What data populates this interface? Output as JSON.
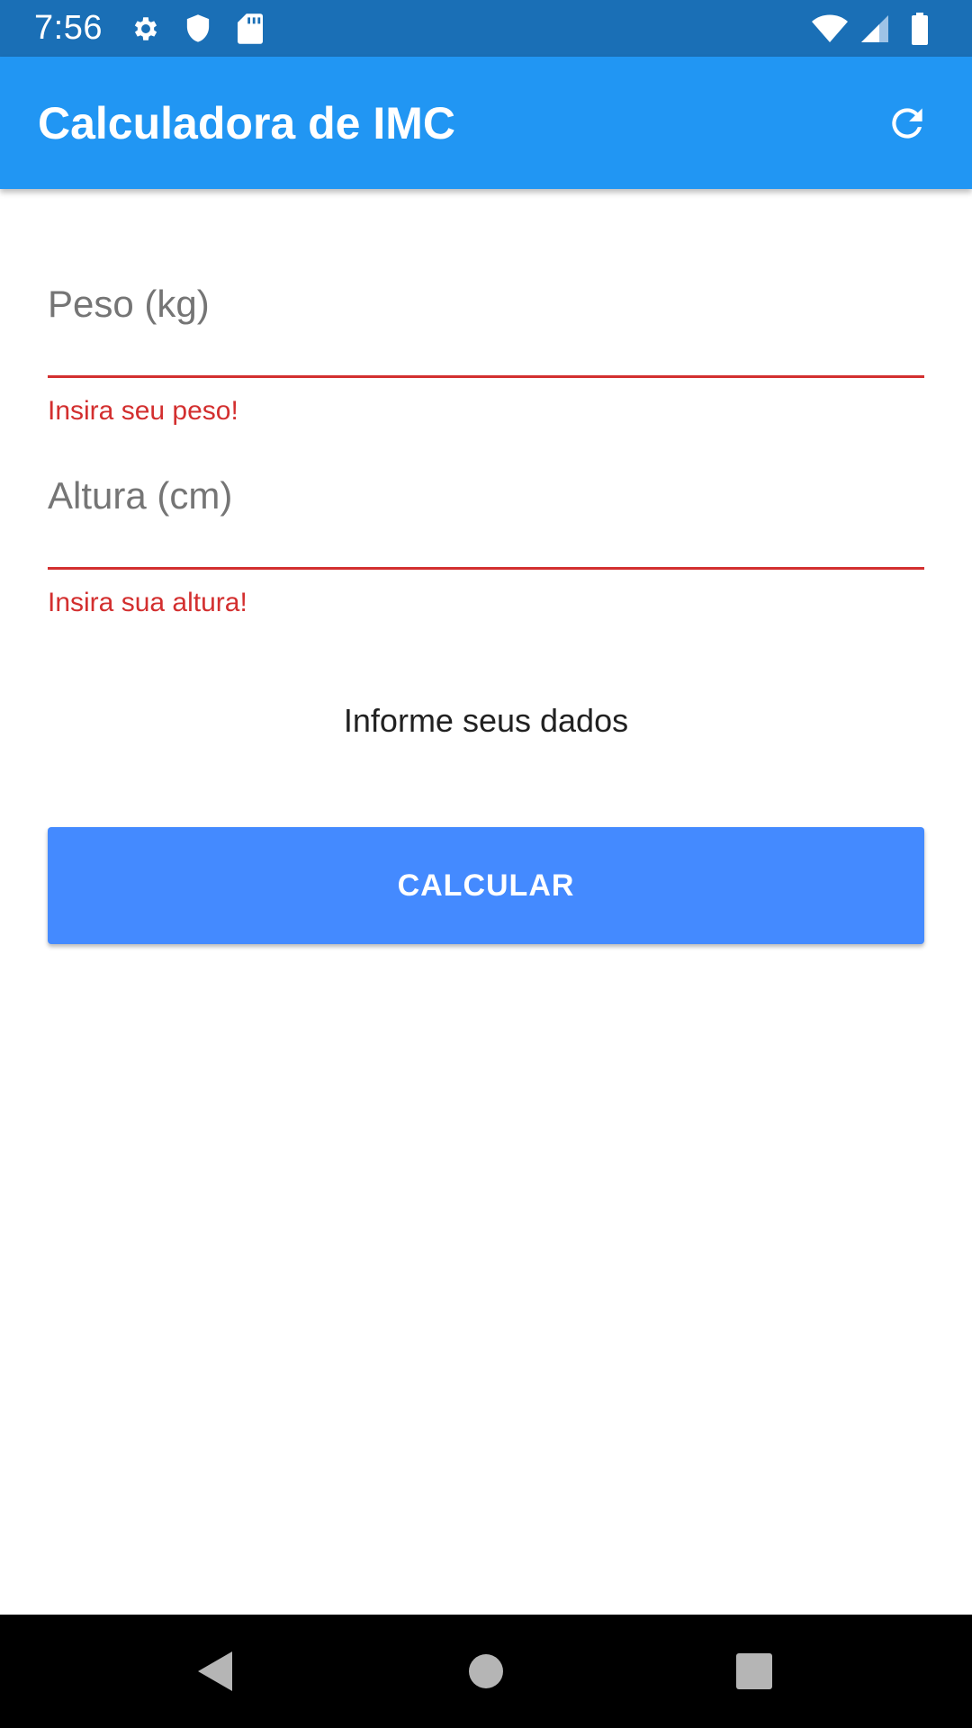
{
  "status_bar": {
    "time": "7:56",
    "left_icons": [
      "gear-icon",
      "shield-icon",
      "sd-card-icon"
    ],
    "right_icons": [
      "wifi-icon",
      "cell-signal-icon",
      "battery-icon"
    ]
  },
  "app_bar": {
    "title": "Calculadora de IMC",
    "action_icon": "refresh-icon"
  },
  "form": {
    "weight": {
      "placeholder": "Peso (kg)",
      "value": "",
      "error": "Insira seu peso!"
    },
    "height": {
      "placeholder": "Altura (cm)",
      "value": "",
      "error": "Insira sua altura!"
    }
  },
  "result_text": "Informe seus dados",
  "calculate_button": "CALCULAR",
  "colors": {
    "status_bar": "#1a6fb6",
    "app_bar": "#2196f3",
    "button": "#448aff",
    "error": "#d32f2f"
  },
  "nav_bar": {
    "icons": [
      "back-icon",
      "home-icon",
      "recents-icon"
    ]
  }
}
